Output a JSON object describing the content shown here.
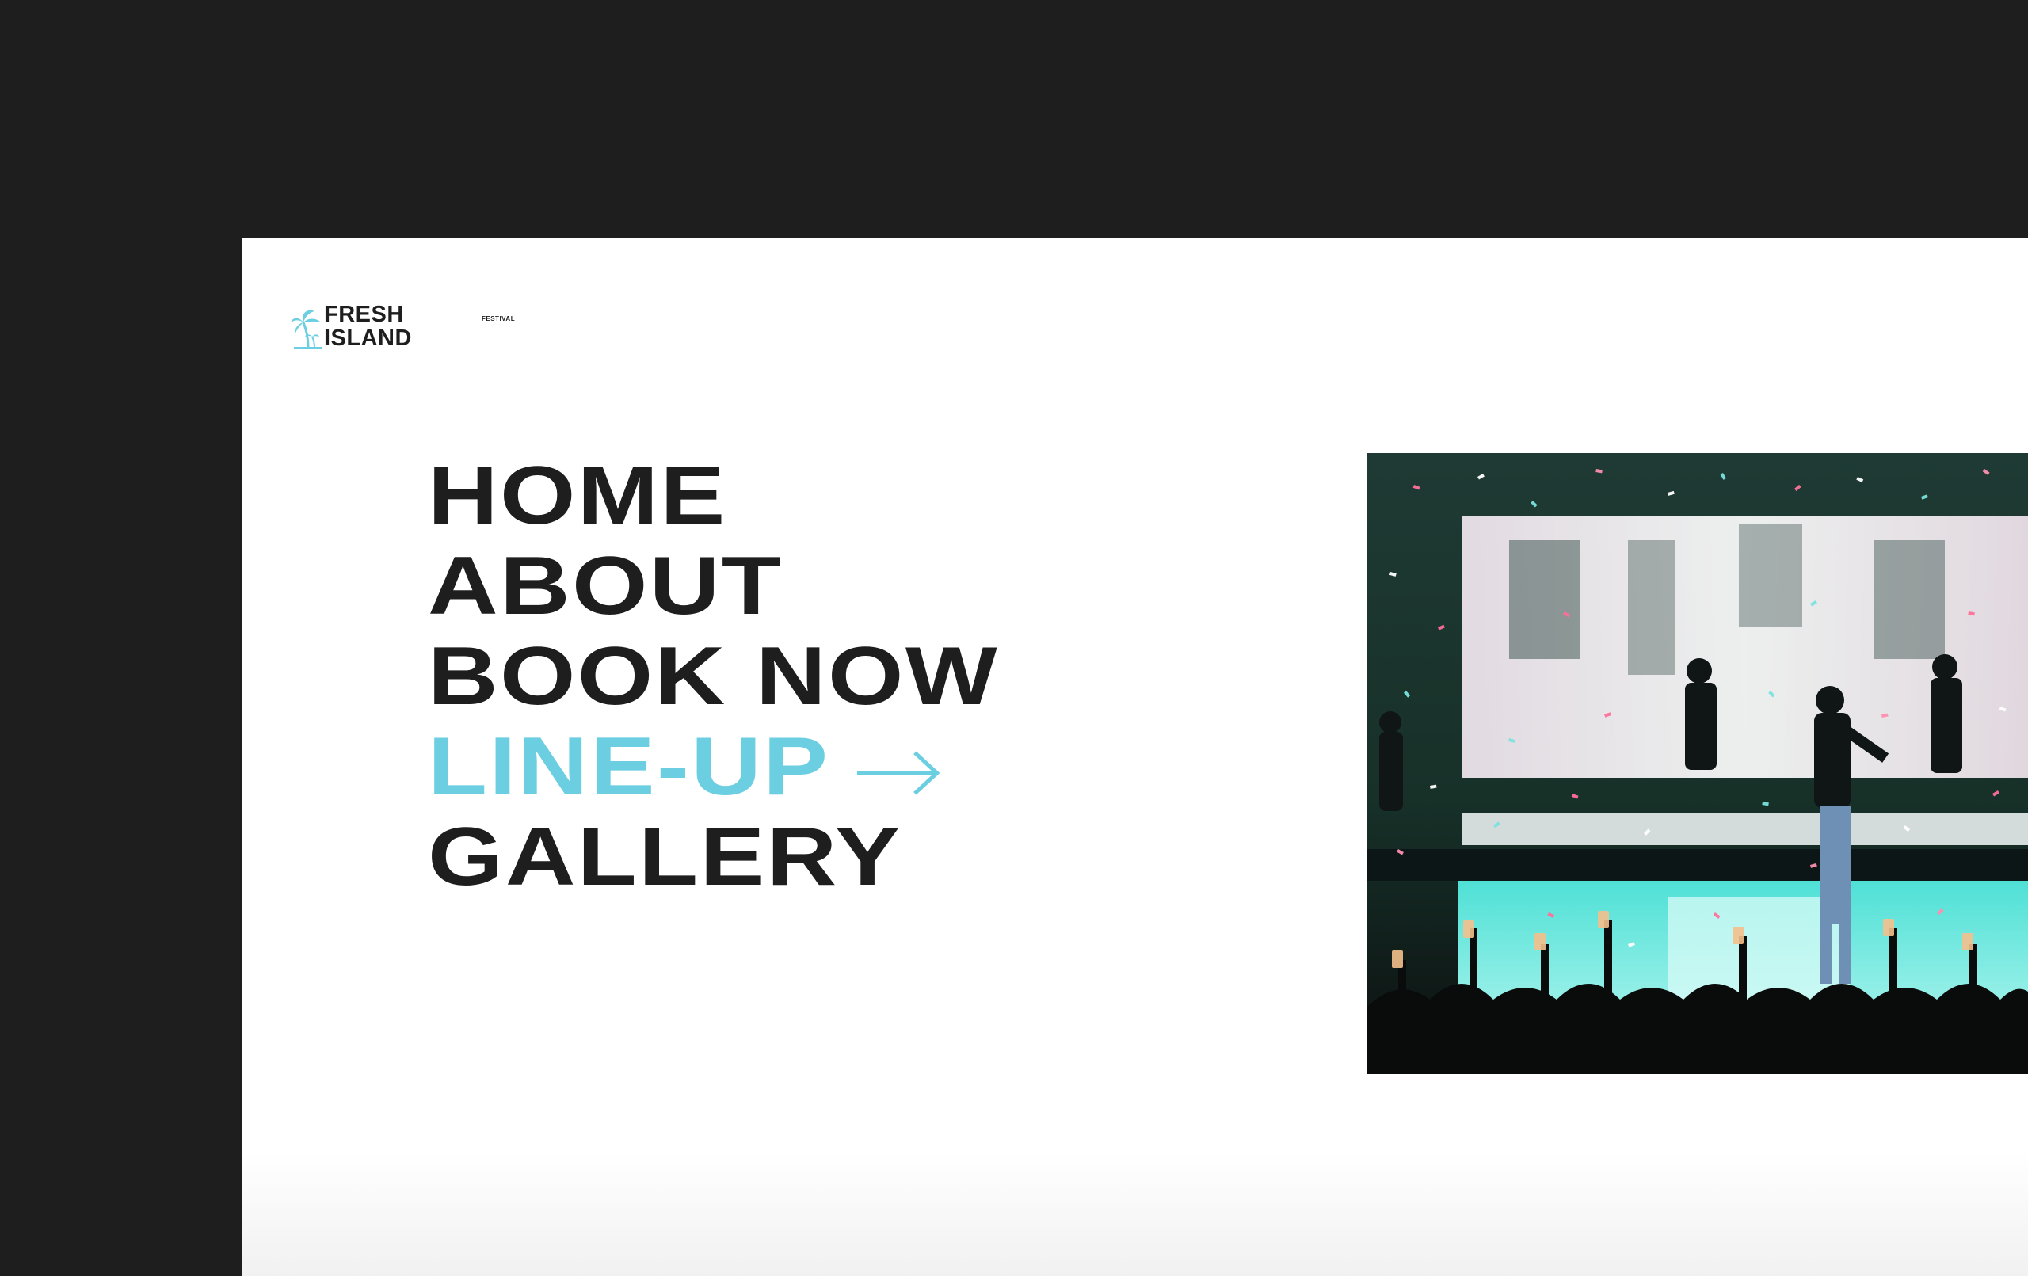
{
  "logo": {
    "line1": "FRESH",
    "line2": "ISLAND",
    "tagline": "FESTIVAL"
  },
  "menu": {
    "items": [
      {
        "label": "HOME",
        "active": false
      },
      {
        "label": "ABOUT",
        "active": false
      },
      {
        "label": "BOOK NOW",
        "active": false
      },
      {
        "label": "LINE-UP",
        "active": true
      },
      {
        "label": "GALLERY",
        "active": false
      }
    ],
    "active_arrow_icon": "arrow-right-icon"
  },
  "colors": {
    "frame": "#1e1e1e",
    "page": "#ffffff",
    "text": "#1e1e1e",
    "accent": "#6ccfe1"
  },
  "photo": {
    "subject": "concert-stage-confetti"
  }
}
